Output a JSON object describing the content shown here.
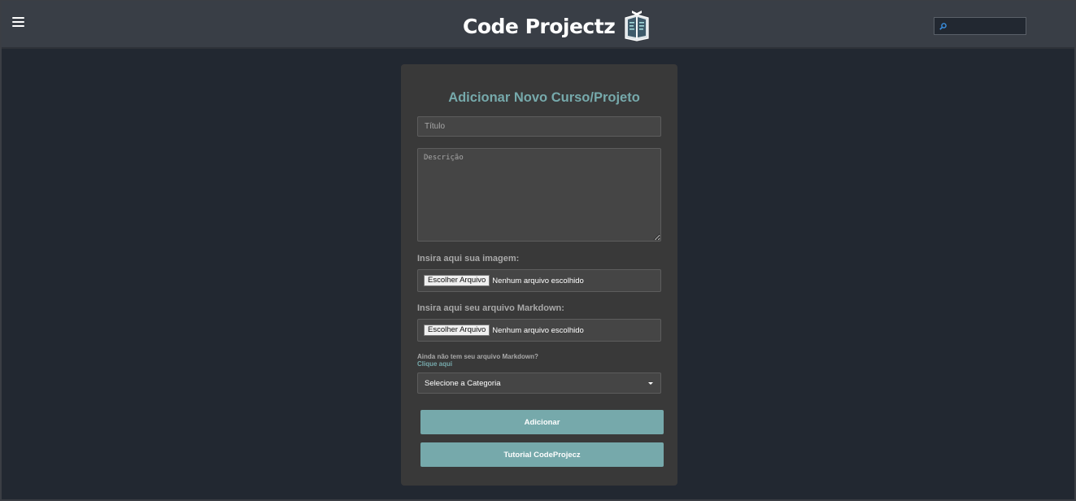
{
  "header": {
    "brand_name": "Code Projectz",
    "search": {
      "value": "",
      "placeholder": ""
    }
  },
  "form": {
    "title": "Adicionar Novo Curso/Projeto",
    "title_placeholder": "Título",
    "description_placeholder": "Descrição",
    "image_label": "Insira aqui sua imagem:",
    "image_button": "Escolher Arquivo",
    "image_status": "Nenhum arquivo escolhido",
    "markdown_label": "Insira aqui seu arquivo Markdown:",
    "markdown_button": "Escolher Arquivo",
    "markdown_status": "Nenhum arquivo escolhido",
    "hint_text": "Ainda não tem seu arquivo Markdown?",
    "hint_link": "Clique aqui",
    "category_selected": "Selecione a Categoria",
    "add_button": "Adicionar",
    "tutorial_button": "Tutorial CodeProjecz"
  },
  "colors": {
    "background": "#222831",
    "topbar": "#393e46",
    "card": "#393939",
    "accent": "#76a9ab"
  }
}
